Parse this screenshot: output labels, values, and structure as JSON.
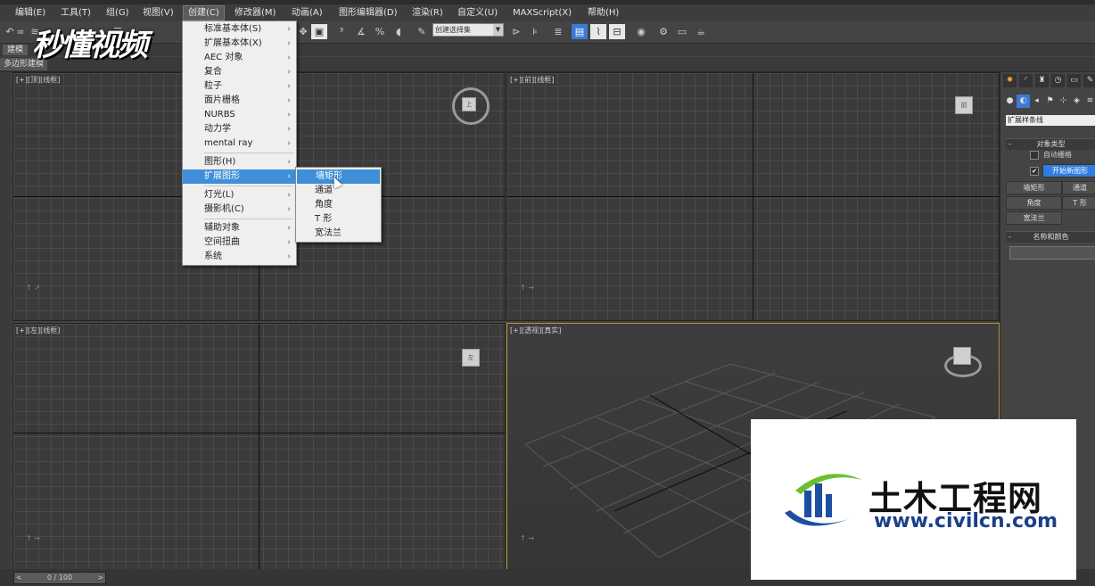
{
  "menubar": {
    "items": [
      "编辑(E)",
      "工具(T)",
      "组(G)",
      "视图(V)",
      "创建(C)",
      "修改器(M)",
      "动画(A)",
      "图形编辑器(D)",
      "渲染(R)",
      "自定义(U)",
      "MAXScript(X)",
      "帮助(H)"
    ]
  },
  "toolbar": {
    "selection_set_placeholder": "创建选择集"
  },
  "ribbon": {
    "tab_modeling": "建模",
    "tab_poly": "多边形建模"
  },
  "create_menu": {
    "items": [
      {
        "label": "标准基本体(S)"
      },
      {
        "label": "扩展基本体(X)"
      },
      {
        "label": "AEC 对象"
      },
      {
        "label": "复合"
      },
      {
        "label": "粒子"
      },
      {
        "label": "面片栅格"
      },
      {
        "label": "NURBS"
      },
      {
        "label": "动力学"
      },
      {
        "label": "mental ray"
      },
      {
        "label": "图形(H)"
      },
      {
        "label": "扩展图形"
      },
      {
        "label": "灯光(L)"
      },
      {
        "label": "摄影机(C)"
      },
      {
        "label": "辅助对象"
      },
      {
        "label": "空间扭曲"
      },
      {
        "label": "系统"
      }
    ],
    "selected": "扩展图形"
  },
  "extended_shapes_submenu": {
    "items": [
      "墙矩形",
      "通道",
      "角度",
      "T 形",
      "宽法兰"
    ],
    "selected": "墙矩形"
  },
  "viewports": {
    "top_left_label": "[+][顶][线框]",
    "top_right_label": "[+][前][线框]",
    "bottom_left_label": "[+][左][线框]",
    "bottom_right_label": "[+][透视][真实]",
    "viewcube_top": "上",
    "viewcube_front": "前",
    "viewcube_left": "左"
  },
  "command_panel": {
    "category": "扩展样条线",
    "object_type_header": "对象类型",
    "auto_grid": "自动栅格",
    "start_new_shape": "开始新图形",
    "start_new_shape_checked": true,
    "buttons": [
      "墙矩形",
      "通道",
      "角度",
      "T 形",
      "宽法兰"
    ],
    "name_color_header": "名称和颜色"
  },
  "timeline": {
    "position": "0 / 100"
  },
  "watermark_left": "秒懂视频",
  "watermark_right": {
    "cn": "土木工程网",
    "url": "www.civilcn.com"
  }
}
